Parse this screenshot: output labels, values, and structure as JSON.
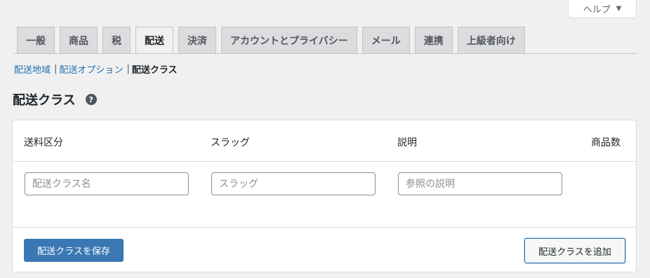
{
  "help": {
    "label": "ヘルプ",
    "caret": "▼"
  },
  "tabs": [
    {
      "label": "一般",
      "active": false
    },
    {
      "label": "商品",
      "active": false
    },
    {
      "label": "税",
      "active": false
    },
    {
      "label": "配送",
      "active": true
    },
    {
      "label": "決済",
      "active": false
    },
    {
      "label": "アカウントとプライバシー",
      "active": false
    },
    {
      "label": "メール",
      "active": false
    },
    {
      "label": "連携",
      "active": false
    },
    {
      "label": "上級者向け",
      "active": false
    }
  ],
  "subnav": {
    "zones": "配送地域",
    "options": "配送オプション",
    "classes": "配送クラス",
    "separator": "|"
  },
  "section": {
    "title": "配送クラス",
    "help_icon": "?"
  },
  "table": {
    "headers": {
      "name": "送料区分",
      "slug": "スラッグ",
      "description": "説明",
      "count": "商品数"
    },
    "inputs": {
      "name_placeholder": "配送クラス名",
      "slug_placeholder": "スラッグ",
      "description_placeholder": "参照の説明"
    }
  },
  "footer": {
    "save_label": "配送クラスを保存",
    "add_label": "配送クラスを追加"
  }
}
